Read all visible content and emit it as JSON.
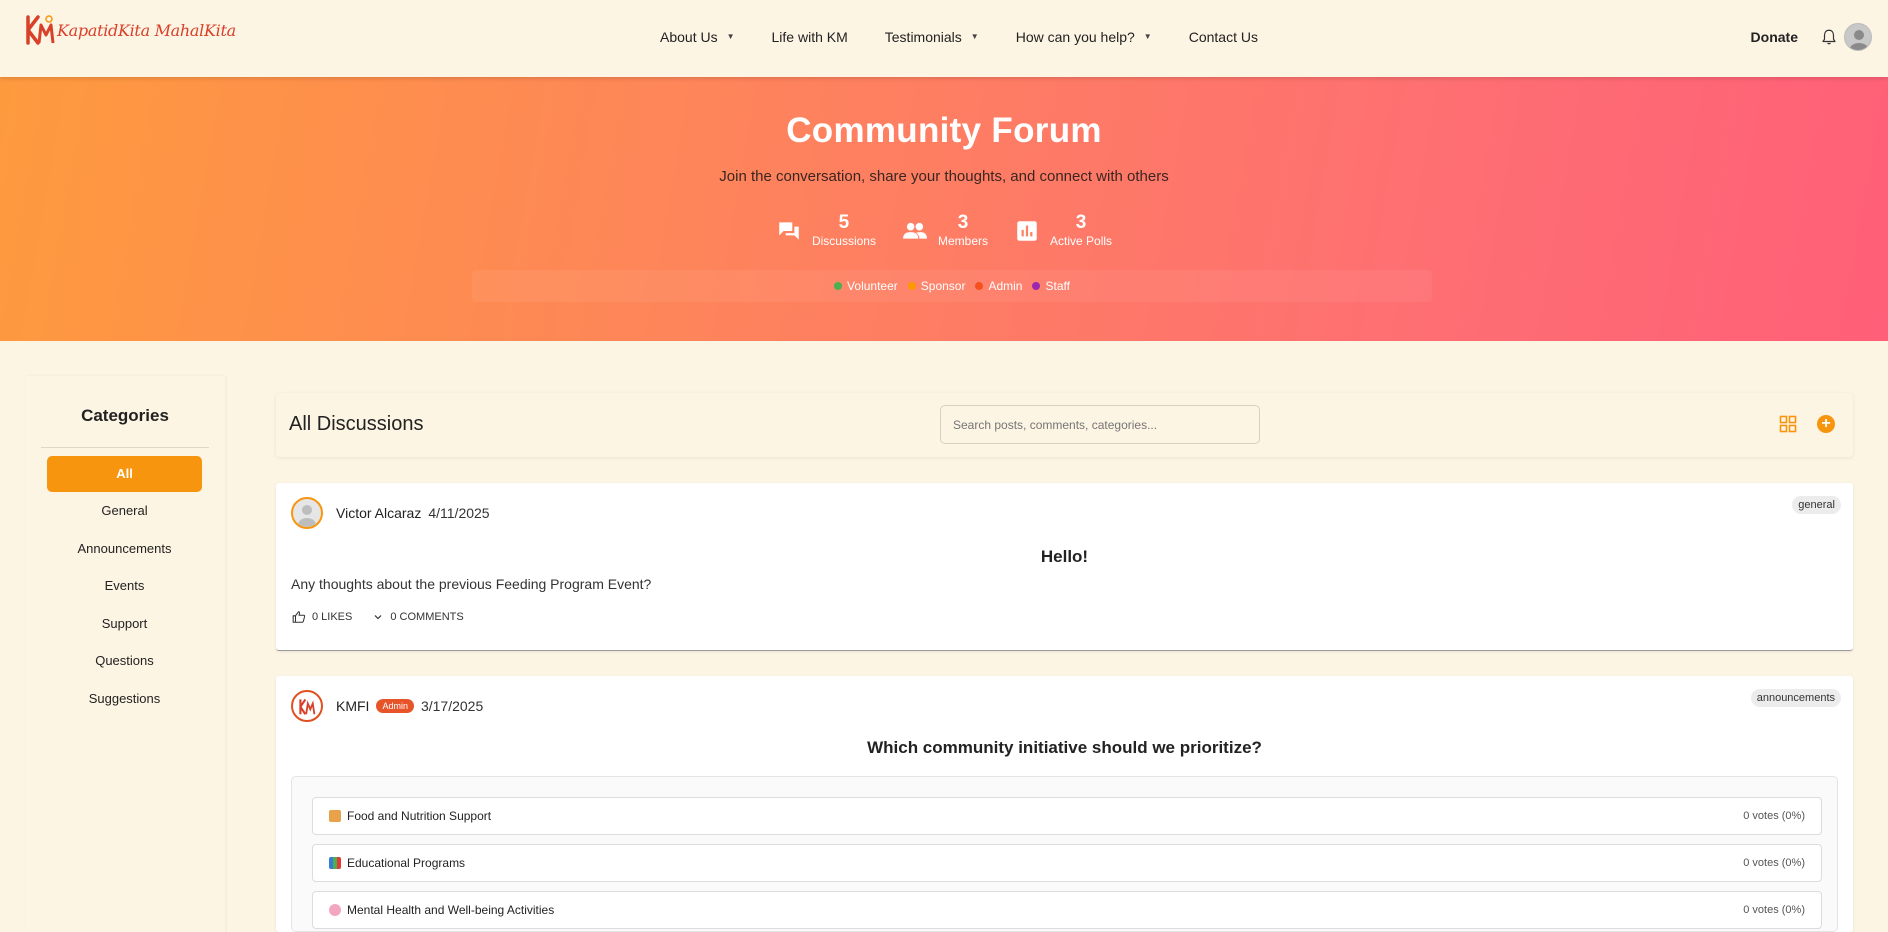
{
  "nav": {
    "logo_text": "KapatidKita MahalKita",
    "items": [
      {
        "label": "About Us",
        "dropdown": true
      },
      {
        "label": "Life with KM",
        "dropdown": false
      },
      {
        "label": "Testimonials",
        "dropdown": true
      },
      {
        "label": "How can you help?",
        "dropdown": true
      },
      {
        "label": "Contact Us",
        "dropdown": false
      }
    ],
    "donate": "Donate"
  },
  "hero": {
    "title": "Community Forum",
    "subtitle": "Join the conversation, share your thoughts, and connect with others",
    "stats": [
      {
        "value": "5",
        "label": "Discussions",
        "icon": "forum-icon"
      },
      {
        "value": "3",
        "label": "Members",
        "icon": "people-icon"
      },
      {
        "value": "3",
        "label": "Active Polls",
        "icon": "poll-icon"
      }
    ],
    "legend": [
      {
        "label": "Volunteer",
        "color": "#4caf50"
      },
      {
        "label": "Sponsor",
        "color": "#ff9800"
      },
      {
        "label": "Admin",
        "color": "#f4511e"
      },
      {
        "label": "Staff",
        "color": "#9c27b0"
      }
    ]
  },
  "sidebar": {
    "title": "Categories",
    "items": [
      "All",
      "General",
      "Announcements",
      "Events",
      "Support",
      "Questions",
      "Suggestions"
    ],
    "active": "All"
  },
  "main": {
    "title": "All Discussions",
    "search_placeholder": "Search posts, comments, categories..."
  },
  "posts": [
    {
      "author": "Victor Alcaraz",
      "date": "4/11/2025",
      "tag": "general",
      "title": "Hello!",
      "body": "Any thoughts about the previous Feeding Program Event?",
      "likes": "0 LIKES",
      "comments": "0 COMMENTS"
    },
    {
      "author": "KMFI",
      "role": "Admin",
      "date": "3/17/2025",
      "tag": "announcements",
      "title": "Which community initiative should we prioritize?",
      "poll": [
        {
          "label": "Food and Nutrition Support",
          "votes": "0 votes (0%)",
          "icon": "food-icon"
        },
        {
          "label": "Educational Programs",
          "votes": "0 votes (0%)",
          "icon": "books-icon"
        },
        {
          "label": "Mental Health and Well-being Activities",
          "votes": "0 votes (0%)",
          "icon": "brain-icon"
        }
      ]
    }
  ],
  "colors": {
    "accent": "#f7950f",
    "hero_start": "#fe9a3e",
    "hero_end": "#ff5f78",
    "background": "#fdf5e4"
  }
}
